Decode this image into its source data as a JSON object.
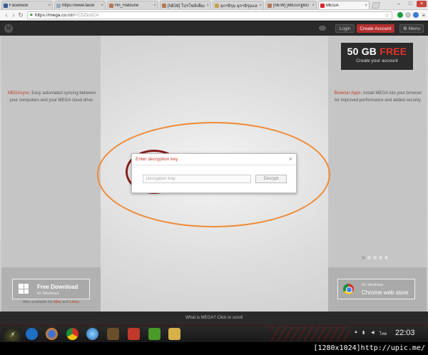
{
  "browser": {
    "tabs": [
      {
        "title": "Facebook",
        "favicon_color": "#3b5998"
      },
      {
        "title": "https://www.facel",
        "favicon_color": "#9ab"
      },
      {
        "title": "Hn_Hatsune",
        "favicon_color": "#b07a55"
      },
      {
        "title": "[NEW] โปรโฟล์เพียง",
        "favicon_color": "#b07a55"
      },
      {
        "title": "ยุกฯอิรุม ยุกฯอิรุมและ",
        "favicon_color": "#c8a050"
      },
      {
        "title": "[NEW] [MEGA][BD",
        "favicon_color": "#b07a55"
      },
      {
        "title": "MEGA",
        "favicon_color": "#d9272e",
        "active": true
      }
    ],
    "url_main": "https://mega.co.nz/",
    "url_hash": "#!C5ZkxICA",
    "extension_colors": [
      "#1a9b3c",
      "#c5c5c5",
      "#3a7bd5"
    ]
  },
  "mega_header": {
    "logo": "M",
    "login_label": "Login",
    "create_label": "Create Account",
    "menu_label": "Menu"
  },
  "left_panel": {
    "highlight": "MEGAsync:",
    "text": " Easy automated syncing between your computers and your MEGA cloud drive.",
    "download_title": "Free Download",
    "download_sub": "for Windows",
    "available_prefix": "Also available for ",
    "available_mac": "Mac",
    "available_and": " and ",
    "available_linux": "Linux"
  },
  "right_panel": {
    "promo_amount": "50 GB",
    "promo_free": "FREE",
    "promo_sub": "Create your account",
    "highlight": "Browser Apps:",
    "text": " Install MEGA into your browser for improved performance and added security.",
    "store_sub": "for Windows",
    "store_title": "Chrome web store",
    "carousel_active_index": 0,
    "carousel_count": 5
  },
  "modal": {
    "title": "Enter decryption key",
    "input_placeholder": "Decryption Key",
    "decrypt_label": "Decrypt",
    "close_glyph": "×"
  },
  "footer": {
    "what_is": "What is MEGA? Click or scroll"
  },
  "taskbar": {
    "app_icons": [
      "ie-icon",
      "firefox-icon",
      "chrome-icon",
      "messenger-icon",
      "media-player-icon",
      "bag-icon",
      "utorrent-icon",
      "folder-icon"
    ],
    "language": "ไทย",
    "time": "22:03"
  },
  "watermark": "[1280x1024]http://upic.me/"
}
